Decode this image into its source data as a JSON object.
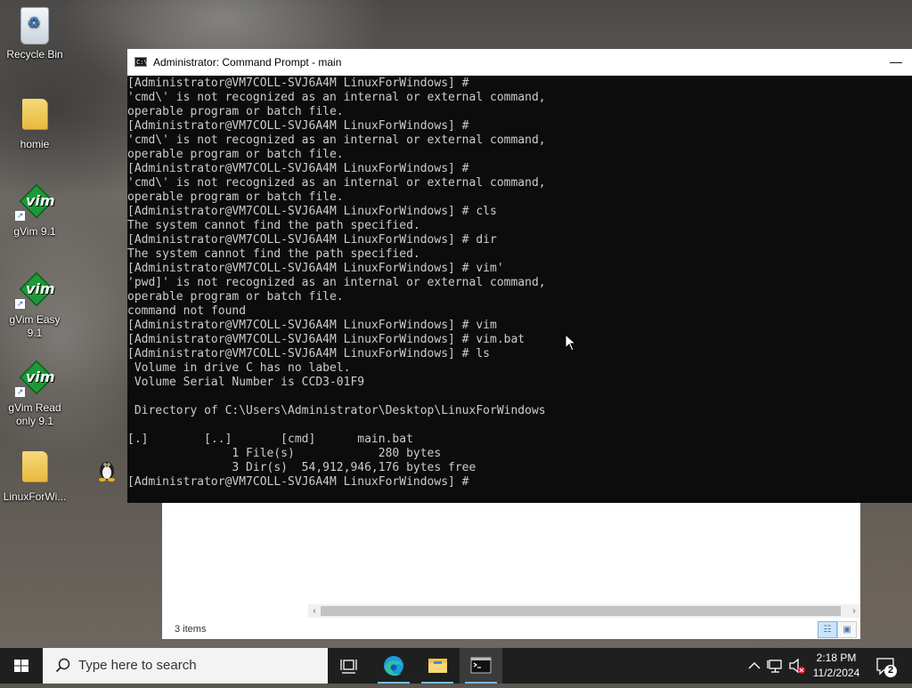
{
  "desktop": {
    "icons": [
      {
        "label": "Recycle Bin",
        "icon": "recycle-bin-icon"
      },
      {
        "label": "homie",
        "icon": "folder-icon"
      },
      {
        "label": "gVim 9.1",
        "icon": "gvim-icon"
      },
      {
        "label": "gVim Easy 9.1",
        "icon": "gvim-icon"
      },
      {
        "label": "gVim Read only 9.1",
        "icon": "gvim-icon"
      },
      {
        "label": "LinuxForWi...",
        "icon": "folder-icon"
      }
    ]
  },
  "cmd_window": {
    "title": "Administrator: Command Prompt - main",
    "minimize_label": "—",
    "lines": [
      "[Administrator@VM7COLL-SVJ6A4M LinuxForWindows] #",
      "'cmd\\' is not recognized as an internal or external command,",
      "operable program or batch file.",
      "[Administrator@VM7COLL-SVJ6A4M LinuxForWindows] #",
      "'cmd\\' is not recognized as an internal or external command,",
      "operable program or batch file.",
      "[Administrator@VM7COLL-SVJ6A4M LinuxForWindows] #",
      "'cmd\\' is not recognized as an internal or external command,",
      "operable program or batch file.",
      "[Administrator@VM7COLL-SVJ6A4M LinuxForWindows] # cls",
      "The system cannot find the path specified.",
      "[Administrator@VM7COLL-SVJ6A4M LinuxForWindows] # dir",
      "The system cannot find the path specified.",
      "[Administrator@VM7COLL-SVJ6A4M LinuxForWindows] # vim'",
      "'pwd]' is not recognized as an internal or external command,",
      "operable program or batch file.",
      "command not found",
      "[Administrator@VM7COLL-SVJ6A4M LinuxForWindows] # vim",
      "[Administrator@VM7COLL-SVJ6A4M LinuxForWindows] # vim.bat",
      "[Administrator@VM7COLL-SVJ6A4M LinuxForWindows] # ls",
      " Volume in drive C has no label.",
      " Volume Serial Number is CCD3-01F9",
      "",
      " Directory of C:\\Users\\Administrator\\Desktop\\LinuxForWindows",
      "",
      "[.]        [..]       [cmd]      main.bat",
      "               1 File(s)            280 bytes",
      "               3 Dir(s)  54,912,946,176 bytes free",
      "[Administrator@VM7COLL-SVJ6A4M LinuxForWindows] #"
    ]
  },
  "explorer_window": {
    "status_text": "3 items",
    "scroll_left": "‹",
    "scroll_right": "›"
  },
  "taskbar": {
    "search_placeholder": "Type here to search",
    "apps": [
      "task-view",
      "edge",
      "file-explorer",
      "command-prompt"
    ],
    "active_app": "command-prompt",
    "tray": {
      "notification_count": "2"
    },
    "clock": {
      "time": "2:18 PM",
      "date": "11/2/2024"
    }
  },
  "colors": {
    "terminal_bg": "#0c0c0c",
    "terminal_fg": "#cccccc",
    "taskbar_bg": "#1f1f1f",
    "accent": "#76b9ed"
  }
}
